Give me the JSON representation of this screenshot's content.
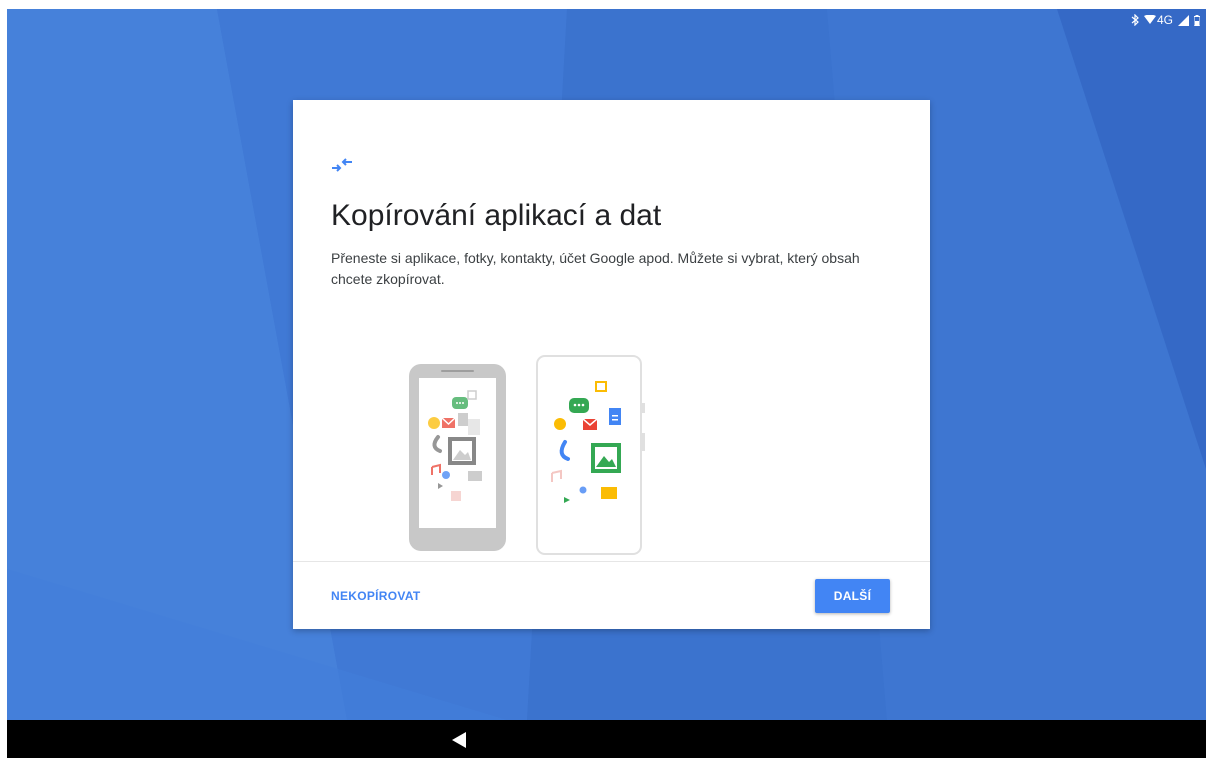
{
  "status_bar": {
    "network_label": "4G",
    "icons": [
      "bluetooth-icon",
      "wifi-icon",
      "signal-icon",
      "battery-icon"
    ]
  },
  "setup_card": {
    "icon": "transfer-arrows-icon",
    "title": "Kopírování aplikací a dat",
    "description": "Přeneste si aplikace, fotky, kontakty, účet Google apod. Můžete si vybrat, který obsah chcete zkopírovat.",
    "illustration": "phones-transfer-illustration",
    "skip_label": "NEKOPÍROVAT",
    "next_label": "DALŠÍ"
  },
  "nav_bar": {
    "icons": [
      "back-icon"
    ]
  },
  "colors": {
    "wallpaper": "#3f78d3",
    "accent": "#4285f4",
    "card": "#ffffff",
    "nav_bar": "#000000"
  }
}
